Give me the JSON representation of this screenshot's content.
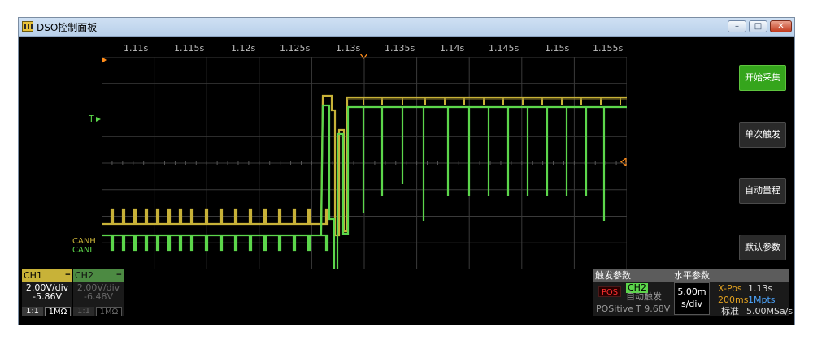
{
  "window": {
    "title": "DSO控制面板"
  },
  "controls": {
    "min": "–",
    "max": "□",
    "close": "✕"
  },
  "time_axis": {
    "labels": [
      "1.11s",
      "1.115s",
      "1.12s",
      "1.125s",
      "1.13s",
      "1.135s",
      "1.14s",
      "1.145s",
      "1.15s",
      "1.155s"
    ]
  },
  "markers": {
    "trigger_level": "T",
    "canh": "CANH",
    "canl": "CANL"
  },
  "side_buttons": {
    "start": "开始采集",
    "single": "单次触发",
    "auto_range": "自动量程",
    "default": "默认参数"
  },
  "ch1": {
    "name": "CH1",
    "scale": "2.00V/div",
    "offset": "-5.86V",
    "probe": "1:1",
    "impedance": "1MΩ",
    "color": "#c8b238"
  },
  "ch2": {
    "name": "CH2",
    "scale": "2.00V/div",
    "offset": "-6.48V",
    "probe": "1:1",
    "impedance": "1MΩ",
    "color": "#5cd64b"
  },
  "trigger": {
    "header": "触发参数",
    "pos": "POS",
    "source": "CH2",
    "mode": "自动触发",
    "slope": "POSitive",
    "level": "T 9.68V"
  },
  "horizontal": {
    "header": "水平参数",
    "time_div": "5.00m",
    "unit": "s/div",
    "xpos_label": "X-Pos",
    "xpos_value": "1.13s",
    "duration": "200ms",
    "memory": "1Mpts",
    "rate_label": "标准",
    "rate_value": "5.00MSa/s"
  }
}
